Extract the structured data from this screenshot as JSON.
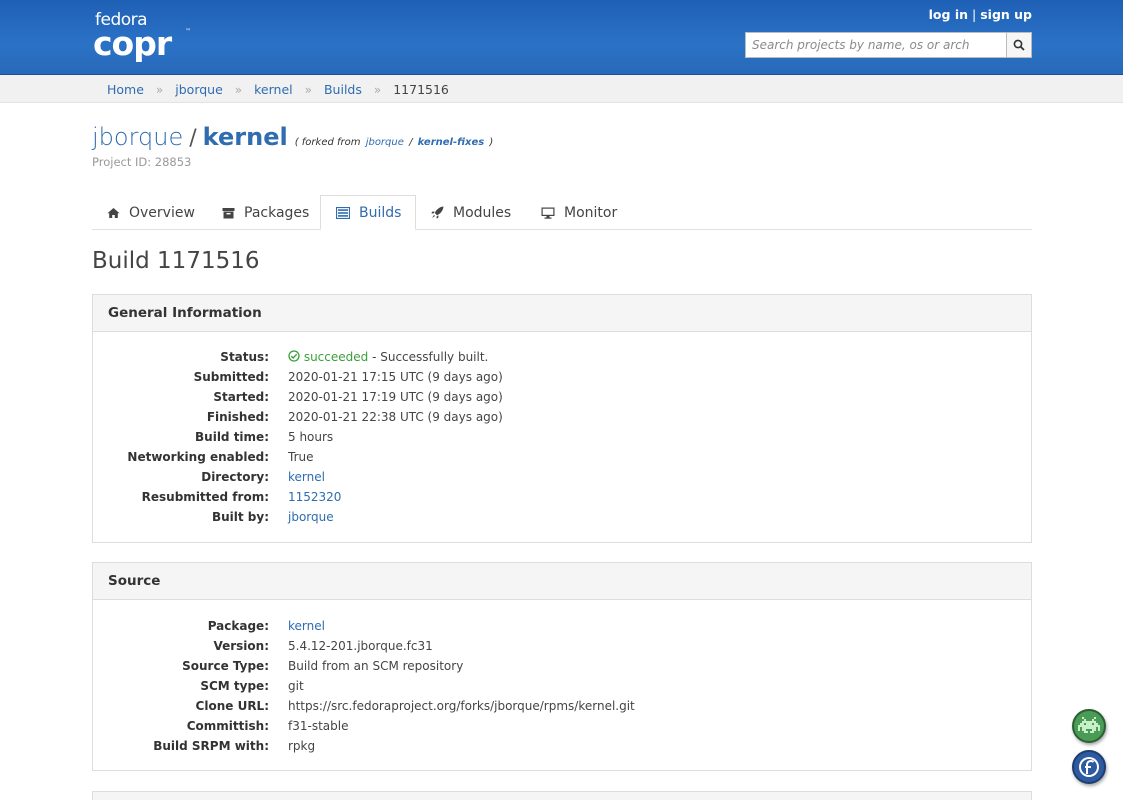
{
  "brand": {
    "top": "fedora",
    "main": "copr",
    "tm": "™"
  },
  "auth": {
    "login": "log in",
    "sep": "|",
    "signup": "sign up"
  },
  "search": {
    "placeholder": "Search projects by name, os or arch"
  },
  "breadcrumb": {
    "items": [
      "Home",
      "jborque",
      "kernel",
      "Builds"
    ],
    "current": "1171516",
    "sep": "»"
  },
  "project": {
    "owner": "jborque",
    "slash": "/",
    "name": "kernel",
    "fork_prefix": "( forked from",
    "fork_owner": "jborque",
    "fork_slash": "/",
    "fork_name": "kernel-fixes",
    "fork_suffix": ")",
    "id_text": "Project ID: 28853"
  },
  "tabs": [
    {
      "label": "Overview",
      "icon": "home-icon"
    },
    {
      "label": "Packages",
      "icon": "archive-icon"
    },
    {
      "label": "Builds",
      "icon": "tasks-icon",
      "active": true
    },
    {
      "label": "Modules",
      "icon": "rocket-icon"
    },
    {
      "label": "Monitor",
      "icon": "desktop-icon"
    }
  ],
  "build_title": "Build 1171516",
  "general": {
    "heading": "General Information",
    "status_label": "Status:",
    "status_value": "succeeded",
    "status_desc": "- Successfully built.",
    "rows": [
      {
        "k": "Submitted:",
        "v": "2020-01-21 17:15 UTC (9 days ago)"
      },
      {
        "k": "Started:",
        "v": "2020-01-21 17:19 UTC (9 days ago)"
      },
      {
        "k": "Finished:",
        "v": "2020-01-21 22:38 UTC (9 days ago)"
      },
      {
        "k": "Build time:",
        "v": "5 hours"
      },
      {
        "k": "Networking enabled:",
        "v": "True"
      }
    ],
    "directory": {
      "k": "Directory:",
      "v": "kernel"
    },
    "resubmitted": {
      "k": "Resubmitted from:",
      "v": "1152320"
    },
    "built_by": {
      "k": "Built by:",
      "v": "jborque"
    }
  },
  "source": {
    "heading": "Source",
    "package": {
      "k": "Package:",
      "v": "kernel"
    },
    "rows": [
      {
        "k": "Version:",
        "v": "5.4.12-201.jborque.fc31"
      },
      {
        "k": "Source Type:",
        "v": "Build from an SCM repository"
      },
      {
        "k": "SCM type:",
        "v": "git"
      },
      {
        "k": "Clone URL:",
        "v": "https://src.fedoraproject.org/forks/jborque/rpms/kernel.git"
      },
      {
        "k": "Committish:",
        "v": "f31-stable"
      },
      {
        "k": "Build SRPM with:",
        "v": "rpkg"
      }
    ]
  },
  "colors": {
    "header": "#2b72c6",
    "link": "#2f6cb0",
    "success": "#3a9f3a"
  }
}
